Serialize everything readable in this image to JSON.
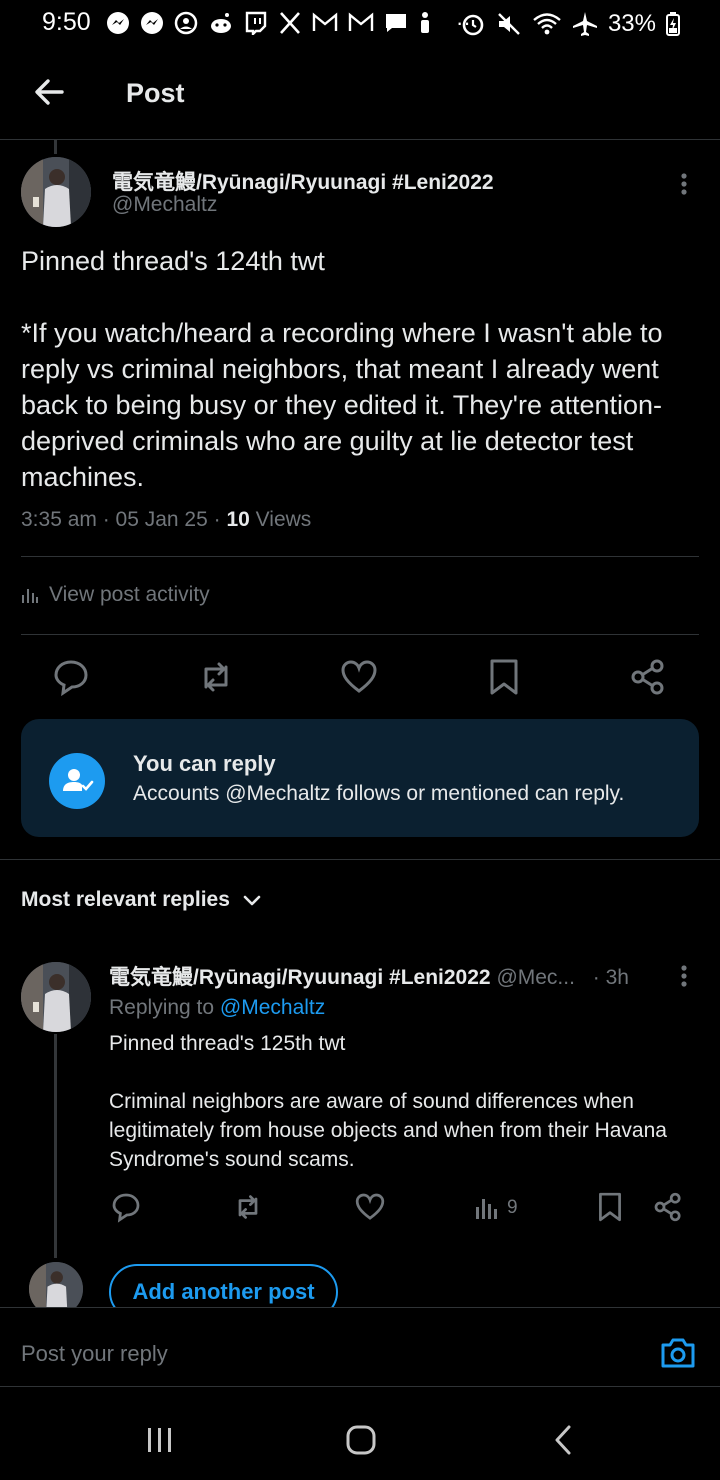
{
  "status_bar": {
    "time": "9:50",
    "battery": "33%"
  },
  "header": {
    "title": "Post"
  },
  "post": {
    "display_name": "電気竜鰻/Ryūnagi/Ryuunagi #Leni2022",
    "handle": "@Mechaltz",
    "text": "Pinned thread's 124th twt\n\n*If you watch/heard a recording where I wasn't able to reply vs criminal neighbors, that meant I already went back to being busy or they edited it. They're attention-deprived criminals who are guilty at lie detector test machines.",
    "timestamp": "3:35 am · 05 Jan 25 · ",
    "views_count": "10",
    "views_label": " Views",
    "activity_label": "View post activity"
  },
  "reply_permission": {
    "title": "You can reply",
    "description": "Accounts @Mechaltz follows or mentioned can reply."
  },
  "replies_filter": {
    "label": "Most relevant replies"
  },
  "reply": {
    "display_name": "電気竜鰻/Ryūnagi/Ryuunagi #Leni2022",
    "handle": "@Mec...",
    "time": "· 3h",
    "replying_prefix": "Replying to ",
    "replying_to": "@Mechaltz",
    "text": "Pinned thread's 125th twt\n\nCriminal neighbors are aware of sound differences when legitimately from house objects and when from their Havana Syndrome's sound scams.",
    "views": "9"
  },
  "add_post": {
    "label": "Add another post"
  },
  "composer": {
    "placeholder": "Post your reply"
  },
  "colors": {
    "background": "#000000",
    "text": "#e7e9ea",
    "muted": "#71767b",
    "accent": "#1d9bf0",
    "card": "#0b2030",
    "divider": "#2f3336"
  },
  "icons": [
    "messenger-icon",
    "face-icon",
    "reddit-icon",
    "twitch-icon",
    "x-icon",
    "gmail-icon",
    "chat-icon",
    "alarm-icon",
    "mute-icon",
    "wifi-icon",
    "airplane-icon",
    "battery-icon"
  ]
}
